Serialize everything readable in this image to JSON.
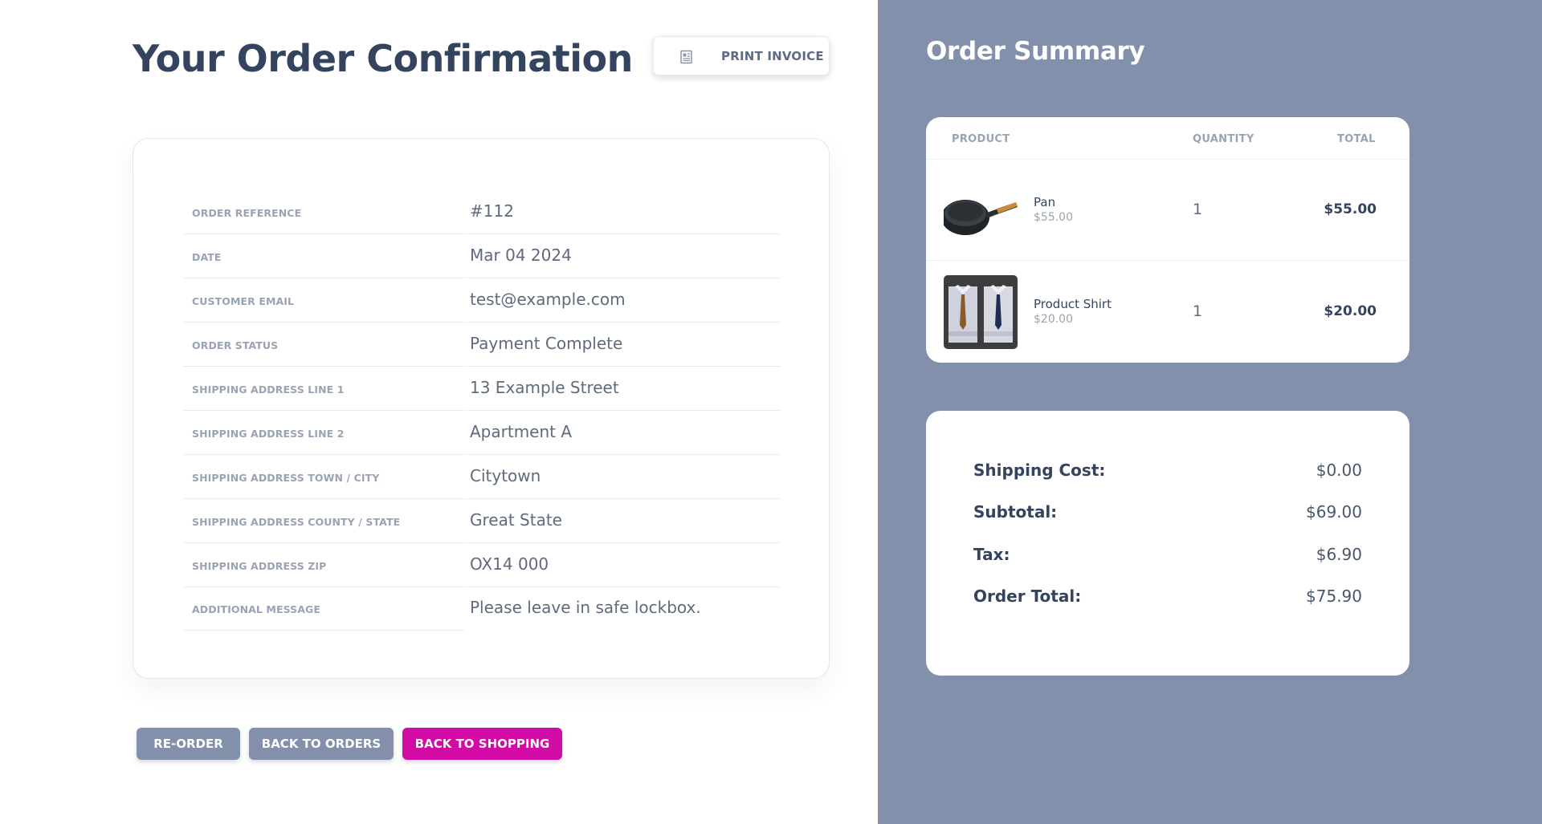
{
  "page": {
    "title": "Your Order Confirmation",
    "print_button_label": "PRINT INVOICE"
  },
  "details": [
    {
      "label": "ORDER REFERENCE",
      "value": "#112"
    },
    {
      "label": "DATE",
      "value": "Mar 04 2024"
    },
    {
      "label": "CUSTOMER EMAIL",
      "value": "test@example.com"
    },
    {
      "label": "ORDER STATUS",
      "value": "Payment Complete"
    },
    {
      "label": "SHIPPING ADDRESS LINE 1",
      "value": "13 Example Street"
    },
    {
      "label": "SHIPPING ADDRESS LINE 2",
      "value": "Apartment A"
    },
    {
      "label": "SHIPPING ADDRESS TOWN / CITY",
      "value": "Citytown"
    },
    {
      "label": "SHIPPING ADDRESS COUNTY / STATE",
      "value": "Great State"
    },
    {
      "label": "SHIPPING ADDRESS ZIP",
      "value": "OX14 000"
    },
    {
      "label": "ADDITIONAL MESSAGE",
      "value": "Please leave in safe lockbox."
    }
  ],
  "actions": {
    "reorder": "RE-ORDER",
    "back_to_orders": "BACK TO ORDERS",
    "back_to_shopping": "BACK TO SHOPPING"
  },
  "summary": {
    "title": "Order Summary",
    "columns": {
      "product": "PRODUCT",
      "quantity": "QUANTITY",
      "total": "TOTAL"
    },
    "items": [
      {
        "name": "Pan",
        "price": "$55.00",
        "quantity": "1",
        "total": "$55.00",
        "image": "frying-pan-image"
      },
      {
        "name": "Product Shirt",
        "price": "$20.00",
        "quantity": "1",
        "total": "$20.00",
        "image": "shirts-image"
      }
    ],
    "totals": [
      {
        "label": "Shipping Cost:",
        "value": "$0.00"
      },
      {
        "label": "Subtotal:",
        "value": "$69.00"
      },
      {
        "label": "Tax:",
        "value": "$6.90"
      },
      {
        "label": "Order Total:",
        "value": "$75.90"
      }
    ]
  },
  "colors": {
    "panel_bg": "#8290ab",
    "accent": "#d10ba4",
    "heading": "#34445f"
  },
  "icons": {
    "print": "print-icon"
  }
}
